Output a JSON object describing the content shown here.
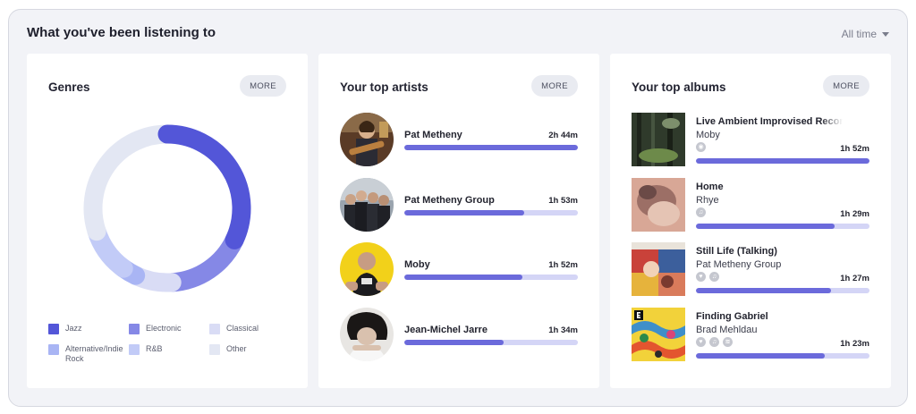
{
  "header": {
    "title": "What you've been listening to",
    "filter": "All time"
  },
  "more_label": "MORE",
  "genres": {
    "title": "Genres",
    "legend": [
      {
        "label": "Jazz",
        "color": "#5356d8"
      },
      {
        "label": "Electronic",
        "color": "#8588e6"
      },
      {
        "label": "Classical",
        "color": "#d9dcf5"
      },
      {
        "label": "Alternative/Indie Rock",
        "color": "#a9b5f4"
      },
      {
        "label": "R&B",
        "color": "#c2cbf7"
      },
      {
        "label": "Other",
        "color": "#e3e7f3"
      }
    ],
    "chart_data": {
      "type": "pie",
      "categories": [
        "Jazz",
        "Electronic",
        "Classical",
        "Alternative/Indie Rock",
        "R&B",
        "Other"
      ],
      "values": [
        32,
        17,
        8,
        3,
        10,
        30
      ]
    }
  },
  "artists": {
    "title": "Your top artists",
    "items": [
      {
        "name": "Pat Metheny",
        "duration": "2h 44m",
        "progress": 1.0
      },
      {
        "name": "Pat Metheny Group",
        "duration": "1h 53m",
        "progress": 0.69
      },
      {
        "name": "Moby",
        "duration": "1h 52m",
        "progress": 0.68
      },
      {
        "name": "Jean-Michel Jarre",
        "duration": "1h 34m",
        "progress": 0.57
      }
    ]
  },
  "albums": {
    "title": "Your top albums",
    "items": [
      {
        "title": "Live Ambient Improvised Recordings",
        "artist": "Moby",
        "duration": "1h 52m",
        "progress": 1.0,
        "icons": [
          "disc-icon"
        ]
      },
      {
        "title": "Home",
        "artist": "Rhye",
        "duration": "1h 29m",
        "progress": 0.8,
        "icons": [
          "music-service-icon"
        ]
      },
      {
        "title": "Still Life (Talking)",
        "artist": "Pat Metheny Group",
        "duration": "1h 27m",
        "progress": 0.78,
        "icons": [
          "heart-icon",
          "music-service-icon"
        ]
      },
      {
        "title": "Finding Gabriel",
        "artist": "Brad Mehldau",
        "duration": "1h 23m",
        "progress": 0.74,
        "icons": [
          "heart-icon",
          "music-service-icon",
          "radio-icon"
        ]
      }
    ]
  }
}
